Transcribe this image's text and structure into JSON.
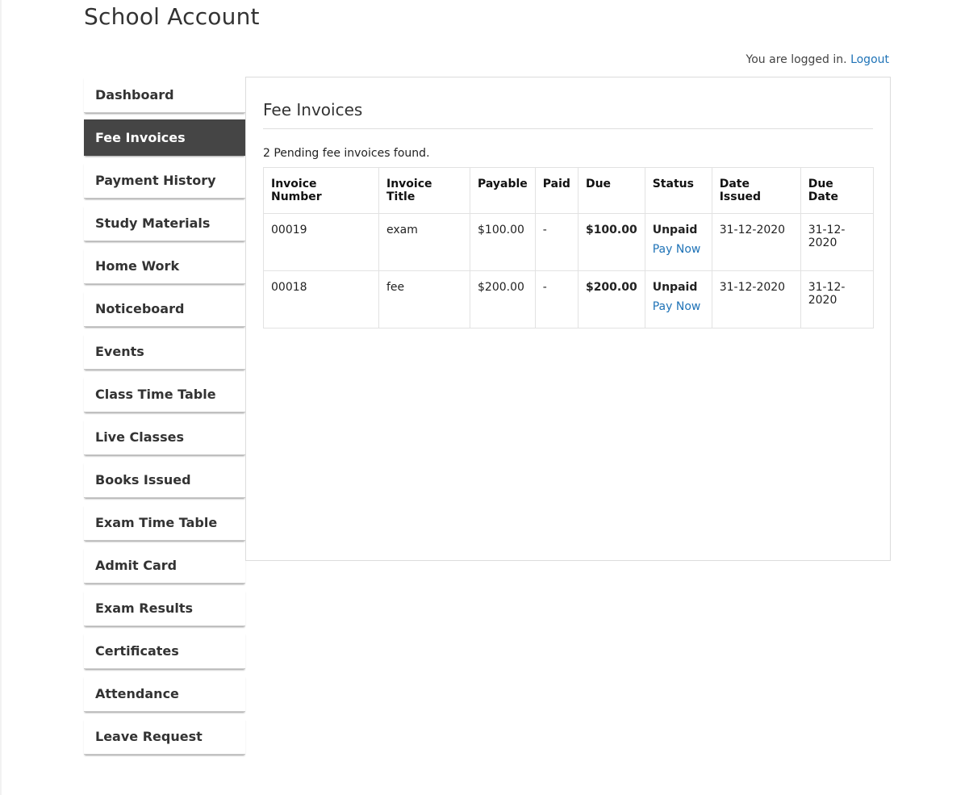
{
  "site": {
    "title": "School Account"
  },
  "auth": {
    "status_text": "You are logged in.",
    "logout_label": "Logout"
  },
  "sidebar": {
    "items": [
      {
        "label": "Dashboard",
        "active": false
      },
      {
        "label": "Fee Invoices",
        "active": true
      },
      {
        "label": "Payment History",
        "active": false
      },
      {
        "label": "Study Materials",
        "active": false
      },
      {
        "label": "Home Work",
        "active": false
      },
      {
        "label": "Noticeboard",
        "active": false
      },
      {
        "label": "Events",
        "active": false
      },
      {
        "label": "Class Time Table",
        "active": false
      },
      {
        "label": "Live Classes",
        "active": false
      },
      {
        "label": "Books Issued",
        "active": false
      },
      {
        "label": "Exam Time Table",
        "active": false
      },
      {
        "label": "Admit Card",
        "active": false
      },
      {
        "label": "Exam Results",
        "active": false
      },
      {
        "label": "Certificates",
        "active": false
      },
      {
        "label": "Attendance",
        "active": false
      },
      {
        "label": "Leave Request",
        "active": false
      }
    ]
  },
  "main": {
    "title": "Fee Invoices",
    "result_text": "2 Pending fee invoices found.",
    "table": {
      "columns": [
        "Invoice Number",
        "Invoice Title",
        "Payable",
        "Paid",
        "Due",
        "Status",
        "Date Issued",
        "Due Date"
      ],
      "rows": [
        {
          "invoice_number": "00019",
          "title": "exam",
          "payable": "$100.00",
          "paid": "-",
          "due": "$100.00",
          "status": "Unpaid",
          "action": "Pay Now",
          "date_issued": "31-12-2020",
          "due_date": "31-12-2020"
        },
        {
          "invoice_number": "00018",
          "title": "fee",
          "payable": "$200.00",
          "paid": "-",
          "due": "$200.00",
          "status": "Unpaid",
          "action": "Pay Now",
          "date_issued": "31-12-2020",
          "due_date": "31-12-2020"
        }
      ]
    }
  },
  "colors": {
    "link": "#1f73b7",
    "active_nav_bg": "#454545"
  }
}
